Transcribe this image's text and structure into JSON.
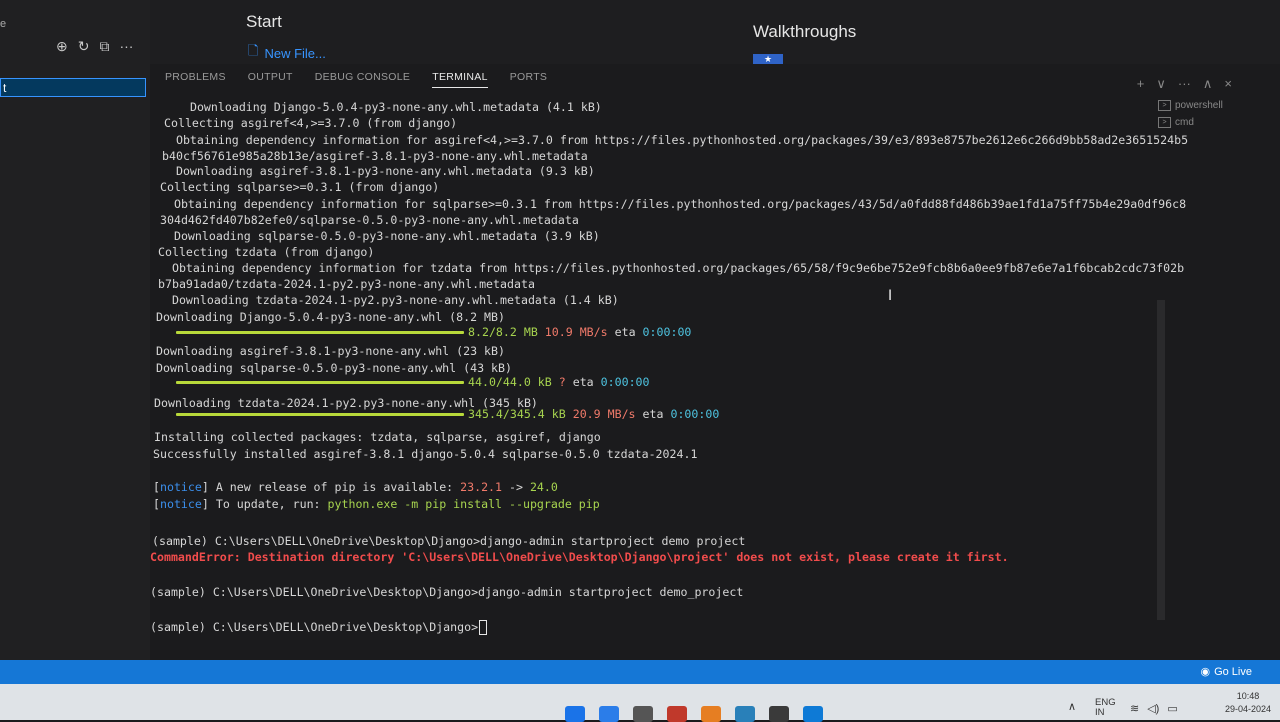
{
  "sidebar": {
    "left_char": "e",
    "selected_char": "t",
    "icons": [
      "new-file-icon",
      "refresh-icon",
      "collapse-icon",
      "more-icon"
    ],
    "icon_glyphs": [
      "⊕",
      "↻",
      "⧉",
      "···"
    ]
  },
  "welcome": {
    "start_title": "Start",
    "new_file_label": "New File...",
    "walkthroughs_title": "Walkthroughs",
    "walkthrough_item": "★"
  },
  "panel": {
    "tabs": [
      "PROBLEMS",
      "OUTPUT",
      "DEBUG CONSOLE",
      "TERMINAL",
      "PORTS"
    ],
    "active_tab": "TERMINAL",
    "actions": [
      "+",
      "∨",
      "···",
      "∧",
      "×"
    ]
  },
  "terminal_list": [
    {
      "name": "powershell"
    },
    {
      "name": "cmd"
    }
  ],
  "terminal": {
    "l1": "  Downloading Django-5.0.4-py3-none-any.whl.metadata (4.1 kB)",
    "l2": "Collecting asgiref<4,>=3.7.0 (from django)",
    "l3": "  Obtaining dependency information for asgiref<4,>=3.7.0 from https://files.pythonhosted.org/packages/39/e3/893e8757be2612e6c266d9bb58ad2e3651524b5",
    "l4": "b40cf56761e985a28b13e/asgiref-3.8.1-py3-none-any.whl.metadata",
    "l5": "  Downloading asgiref-3.8.1-py3-none-any.whl.metadata (9.3 kB)",
    "l6": "Collecting sqlparse>=0.3.1 (from django)",
    "l7": "  Obtaining dependency information for sqlparse>=0.3.1 from https://files.pythonhosted.org/packages/43/5d/a0fdd88fd486b39ae1fd1a75ff75b4e29a0df96c8",
    "l8": "304d462fd407b82efe0/sqlparse-0.5.0-py3-none-any.whl.metadata",
    "l9": "  Downloading sqlparse-0.5.0-py3-none-any.whl.metadata (3.9 kB)",
    "l10": "Collecting tzdata (from django)",
    "l11": "  Obtaining dependency information for tzdata from https://files.pythonhosted.org/packages/65/58/f9c9e6be752e9fcb8b6a0ee9fb87e6e7a1f6bcab2cdc73f02b",
    "l12": "b7ba91ada0/tzdata-2024.1-py2.py3-none-any.whl.metadata",
    "l13": "  Downloading tzdata-2024.1-py2.py3-none-any.whl.metadata (1.4 kB)",
    "l14": "Downloading Django-5.0.4-py3-none-any.whl (8.2 MB)",
    "p1_size": "8.2/8.2 MB",
    "p1_speed": "10.9 MB/s",
    "p1_eta_label": "eta",
    "p1_eta": "0:00:00",
    "l15": "Downloading asgiref-3.8.1-py3-none-any.whl (23 kB)",
    "l16": "Downloading sqlparse-0.5.0-py3-none-any.whl (43 kB)",
    "p2_size": "44.0/44.0 kB",
    "p2_speed": "?",
    "p2_eta_label": "eta",
    "p2_eta": "0:00:00",
    "l17": "Downloading tzdata-2024.1-py2.py3-none-any.whl (345 kB)",
    "p3_size": "345.4/345.4 kB",
    "p3_speed": "20.9 MB/s",
    "p3_eta_label": "eta",
    "p3_eta": "0:00:00",
    "l18": "Installing collected packages: tzdata, sqlparse, asgiref, django",
    "l19": "Successfully installed asgiref-3.8.1 django-5.0.4 sqlparse-0.5.0 tzdata-2024.1",
    "notice_tag": "notice",
    "n1_text": " A new release of pip is available: ",
    "n1_old": "23.2.1",
    "n1_arrow": " -> ",
    "n1_new": "24.0",
    "n2_text": " To update, run: ",
    "n2_cmd": "python.exe -m pip install --upgrade pip",
    "c1": "(sample) C:\\Users\\DELL\\OneDrive\\Desktop\\Django>django-admin startproject demo project",
    "e1": "CommandError: Destination directory 'C:\\Users\\DELL\\OneDrive\\Desktop\\Django\\project' does not exist, please create it first.",
    "c2": "(sample) C:\\Users\\DELL\\OneDrive\\Desktop\\Django>django-admin startproject demo_project",
    "c3": "(sample) C:\\Users\\DELL\\OneDrive\\Desktop\\Django>"
  },
  "progress": [
    1.0,
    1.0,
    1.0
  ],
  "statusbar": {
    "go_live": "Go Live"
  },
  "taskbar": {
    "lang": "ENG",
    "lang2": "IN",
    "time": "10:48",
    "date": "29-04-2024",
    "app_colors": [
      "#1a73e8",
      "#2b7de9",
      "#555555",
      "#c0392b",
      "#e67e22",
      "#2980b9",
      "#3a3a3a",
      "#0e7ad6"
    ]
  },
  "colors": {
    "accent_blue": "#1577d6",
    "progress_green": "#b8d93a",
    "error_red": "#f14c4c"
  }
}
